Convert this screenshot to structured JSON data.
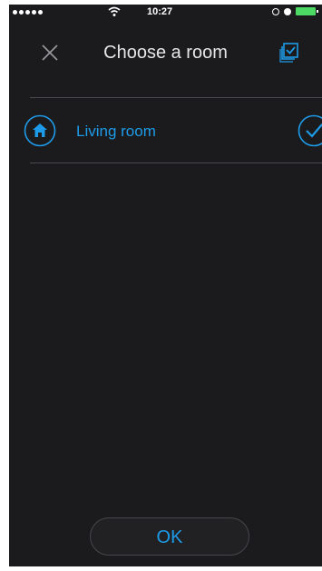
{
  "status_bar": {
    "time": "10:27",
    "battery_color": "#4cd964"
  },
  "header": {
    "title": "Choose a room",
    "close_icon": "close-icon",
    "select_all_icon": "select-all-icon"
  },
  "rooms": [
    {
      "label": "Living room",
      "icon": "home-icon",
      "selected": true
    }
  ],
  "footer": {
    "ok_label": "OK"
  },
  "colors": {
    "accent": "#1e9be8",
    "background": "#1b1b1d",
    "divider": "#4a4a4e"
  }
}
